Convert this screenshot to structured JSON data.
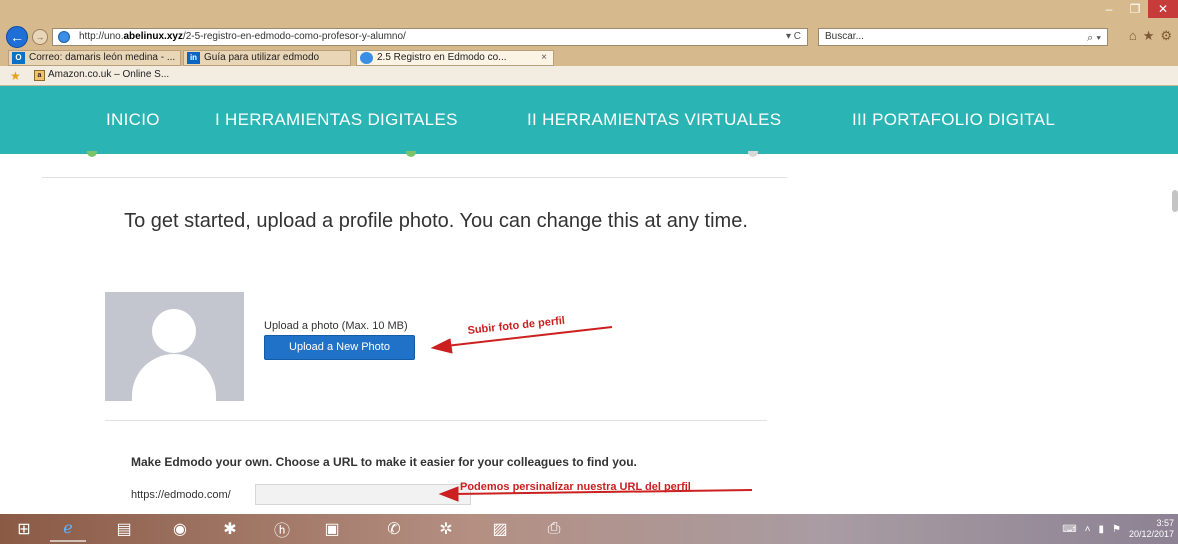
{
  "browser": {
    "url_prefix": "http://uno.",
    "url_domain": "abelinux.xyz",
    "url_path": "/2-5-registro-en-edmodo-como-profesor-y-alumno/",
    "address_tools": "▾ C",
    "search_placeholder": "Buscar...",
    "tabs": [
      {
        "icon_text": "O",
        "icon_color": "#0a72c6",
        "label": "Correo: damaris león medina - ..."
      },
      {
        "icon_text": "in",
        "icon_color": "#0a66c2",
        "label": "Guía para utilizar edmodo"
      },
      {
        "icon_text": "",
        "icon_color": "#3a8ee6",
        "label": "2.5 Registro en Edmodo co...",
        "close": "×"
      }
    ],
    "favorites": [
      {
        "icon_text": "a",
        "label": "Amazon.co.uk – Online S..."
      }
    ]
  },
  "site": {
    "nav": [
      "INICIO",
      "I HERRAMIENTAS DIGITALES",
      "II HERRAMIENTAS VIRTUALES",
      "III PORTAFOLIO DIGITAL"
    ],
    "heading": "To get started, upload a profile photo. You can change this at any time.",
    "upload_label": "Upload a photo (Max. 10 MB)",
    "upload_button": "Upload a New Photo",
    "url_heading": "Make Edmodo your own. Choose a URL to make it easier for your colleagues to find you.",
    "url_prefix": "https://edmodo.com/",
    "url_value": ""
  },
  "annotations": {
    "photo": "Subir foto de perfil",
    "url": "Podemos persinalizar nuestra URL del perfil"
  },
  "taskbar": {
    "clock_time": "3:57",
    "clock_date": "20/12/2017"
  },
  "colors": {
    "nav_bg": "#2ab4b4",
    "button_bg": "#1f72c7",
    "annotation": "#cc1f1f",
    "step_dot": "#7cc46a"
  }
}
